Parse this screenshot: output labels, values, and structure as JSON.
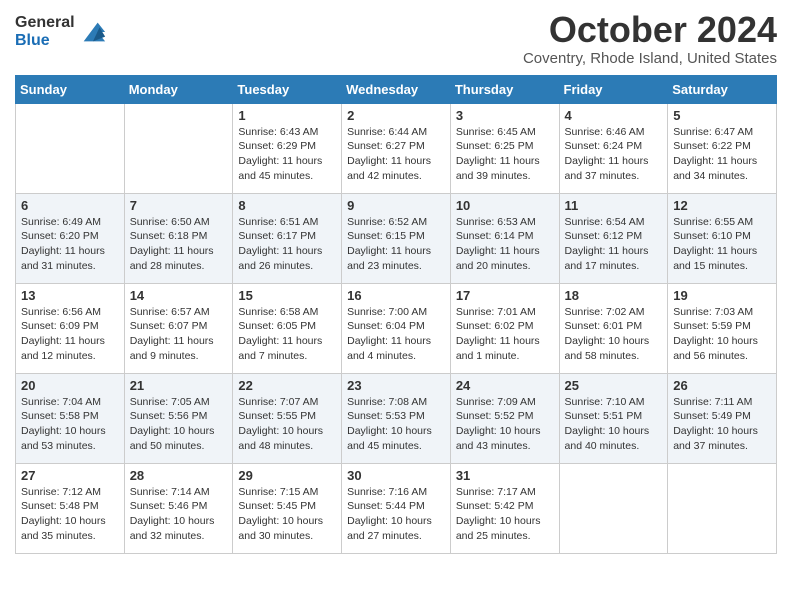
{
  "header": {
    "logo_general": "General",
    "logo_blue": "Blue",
    "month_title": "October 2024",
    "location": "Coventry, Rhode Island, United States"
  },
  "days_of_week": [
    "Sunday",
    "Monday",
    "Tuesday",
    "Wednesday",
    "Thursday",
    "Friday",
    "Saturday"
  ],
  "weeks": [
    [
      {
        "day": "",
        "info": ""
      },
      {
        "day": "",
        "info": ""
      },
      {
        "day": "1",
        "info": "Sunrise: 6:43 AM\nSunset: 6:29 PM\nDaylight: 11 hours and 45 minutes."
      },
      {
        "day": "2",
        "info": "Sunrise: 6:44 AM\nSunset: 6:27 PM\nDaylight: 11 hours and 42 minutes."
      },
      {
        "day": "3",
        "info": "Sunrise: 6:45 AM\nSunset: 6:25 PM\nDaylight: 11 hours and 39 minutes."
      },
      {
        "day": "4",
        "info": "Sunrise: 6:46 AM\nSunset: 6:24 PM\nDaylight: 11 hours and 37 minutes."
      },
      {
        "day": "5",
        "info": "Sunrise: 6:47 AM\nSunset: 6:22 PM\nDaylight: 11 hours and 34 minutes."
      }
    ],
    [
      {
        "day": "6",
        "info": "Sunrise: 6:49 AM\nSunset: 6:20 PM\nDaylight: 11 hours and 31 minutes."
      },
      {
        "day": "7",
        "info": "Sunrise: 6:50 AM\nSunset: 6:18 PM\nDaylight: 11 hours and 28 minutes."
      },
      {
        "day": "8",
        "info": "Sunrise: 6:51 AM\nSunset: 6:17 PM\nDaylight: 11 hours and 26 minutes."
      },
      {
        "day": "9",
        "info": "Sunrise: 6:52 AM\nSunset: 6:15 PM\nDaylight: 11 hours and 23 minutes."
      },
      {
        "day": "10",
        "info": "Sunrise: 6:53 AM\nSunset: 6:14 PM\nDaylight: 11 hours and 20 minutes."
      },
      {
        "day": "11",
        "info": "Sunrise: 6:54 AM\nSunset: 6:12 PM\nDaylight: 11 hours and 17 minutes."
      },
      {
        "day": "12",
        "info": "Sunrise: 6:55 AM\nSunset: 6:10 PM\nDaylight: 11 hours and 15 minutes."
      }
    ],
    [
      {
        "day": "13",
        "info": "Sunrise: 6:56 AM\nSunset: 6:09 PM\nDaylight: 11 hours and 12 minutes."
      },
      {
        "day": "14",
        "info": "Sunrise: 6:57 AM\nSunset: 6:07 PM\nDaylight: 11 hours and 9 minutes."
      },
      {
        "day": "15",
        "info": "Sunrise: 6:58 AM\nSunset: 6:05 PM\nDaylight: 11 hours and 7 minutes."
      },
      {
        "day": "16",
        "info": "Sunrise: 7:00 AM\nSunset: 6:04 PM\nDaylight: 11 hours and 4 minutes."
      },
      {
        "day": "17",
        "info": "Sunrise: 7:01 AM\nSunset: 6:02 PM\nDaylight: 11 hours and 1 minute."
      },
      {
        "day": "18",
        "info": "Sunrise: 7:02 AM\nSunset: 6:01 PM\nDaylight: 10 hours and 58 minutes."
      },
      {
        "day": "19",
        "info": "Sunrise: 7:03 AM\nSunset: 5:59 PM\nDaylight: 10 hours and 56 minutes."
      }
    ],
    [
      {
        "day": "20",
        "info": "Sunrise: 7:04 AM\nSunset: 5:58 PM\nDaylight: 10 hours and 53 minutes."
      },
      {
        "day": "21",
        "info": "Sunrise: 7:05 AM\nSunset: 5:56 PM\nDaylight: 10 hours and 50 minutes."
      },
      {
        "day": "22",
        "info": "Sunrise: 7:07 AM\nSunset: 5:55 PM\nDaylight: 10 hours and 48 minutes."
      },
      {
        "day": "23",
        "info": "Sunrise: 7:08 AM\nSunset: 5:53 PM\nDaylight: 10 hours and 45 minutes."
      },
      {
        "day": "24",
        "info": "Sunrise: 7:09 AM\nSunset: 5:52 PM\nDaylight: 10 hours and 43 minutes."
      },
      {
        "day": "25",
        "info": "Sunrise: 7:10 AM\nSunset: 5:51 PM\nDaylight: 10 hours and 40 minutes."
      },
      {
        "day": "26",
        "info": "Sunrise: 7:11 AM\nSunset: 5:49 PM\nDaylight: 10 hours and 37 minutes."
      }
    ],
    [
      {
        "day": "27",
        "info": "Sunrise: 7:12 AM\nSunset: 5:48 PM\nDaylight: 10 hours and 35 minutes."
      },
      {
        "day": "28",
        "info": "Sunrise: 7:14 AM\nSunset: 5:46 PM\nDaylight: 10 hours and 32 minutes."
      },
      {
        "day": "29",
        "info": "Sunrise: 7:15 AM\nSunset: 5:45 PM\nDaylight: 10 hours and 30 minutes."
      },
      {
        "day": "30",
        "info": "Sunrise: 7:16 AM\nSunset: 5:44 PM\nDaylight: 10 hours and 27 minutes."
      },
      {
        "day": "31",
        "info": "Sunrise: 7:17 AM\nSunset: 5:42 PM\nDaylight: 10 hours and 25 minutes."
      },
      {
        "day": "",
        "info": ""
      },
      {
        "day": "",
        "info": ""
      }
    ]
  ]
}
